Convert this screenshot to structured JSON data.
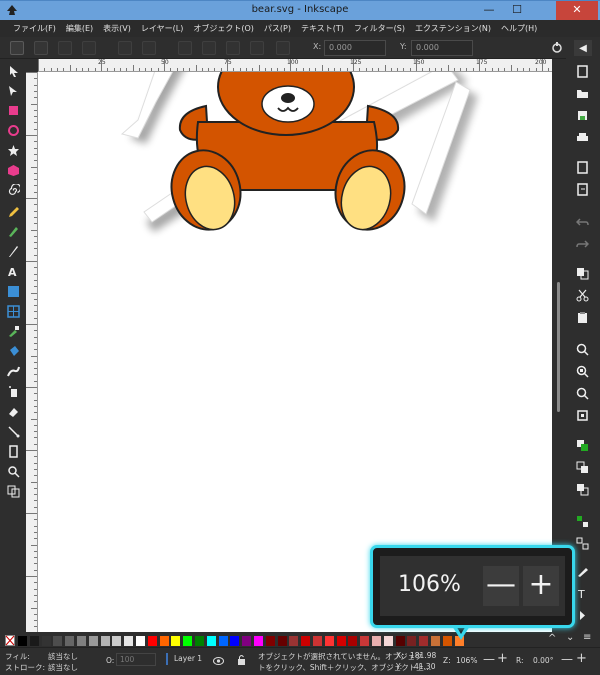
{
  "window": {
    "title": "bear.svg - Inkscape",
    "minimize": "—",
    "maximize": "☐",
    "close": "✕"
  },
  "menu": [
    "ファイル(F)",
    "編集(E)",
    "表示(V)",
    "レイヤー(L)",
    "オブジェクト(O)",
    "パス(P)",
    "テキスト(T)",
    "フィルター(S)",
    "エクステンション(N)",
    "ヘルプ(H)"
  ],
  "controls": {
    "x_label": "X:",
    "x_value": "0.000",
    "y_label": "Y:",
    "y_value": "0.000"
  },
  "ruler": {
    "labels": [
      "25",
      "50",
      "75",
      "100",
      "125",
      "150",
      "175",
      "200"
    ]
  },
  "palette": {
    "colors": [
      "#000000",
      "#1a1a1a",
      "#333333",
      "#4d4d4d",
      "#666666",
      "#808080",
      "#999999",
      "#b3b3b3",
      "#cccccc",
      "#e6e6e6",
      "#ffffff",
      "#ff0000",
      "#ff6600",
      "#ffff00",
      "#00ff00",
      "#008000",
      "#00ffff",
      "#0066ff",
      "#0000ff",
      "#800080",
      "#ff00ff",
      "#800000",
      "#660000",
      "#993333",
      "#cc0000",
      "#cc3333",
      "#ff3333",
      "#d40000",
      "#aa0000",
      "#c83737",
      "#e9afaf",
      "#f4d7d7",
      "#550000",
      "#782121",
      "#a02c2c",
      "#c87137",
      "#d45500",
      "#ff7f2a"
    ]
  },
  "status": {
    "fill_label": "フィル:",
    "fill_value": "該当なし",
    "stroke_label": "ストローク:",
    "stroke_value": "該当なし",
    "opacity_label": "O:",
    "opacity_value": "100",
    "layer": "Layer 1",
    "message_line1": "オブジェクトが選択されていません。オブジェク",
    "message_line2": "トをクリック、Shift＋クリック、オブジェクト上…",
    "x_label": "X:",
    "x_value": "181.98",
    "y_label": "Y:",
    "y_value": "41.30",
    "zoom_label": "Z:",
    "zoom_value": "106%",
    "rotation_label": "R:",
    "rotation_value": "0.00°"
  },
  "callout": {
    "zoom_value": "106%",
    "minus": "—",
    "plus": "+"
  },
  "colors": {
    "bear_body": "#d35400",
    "bear_feet": "#ffe082",
    "accent": "#38d7ec"
  }
}
